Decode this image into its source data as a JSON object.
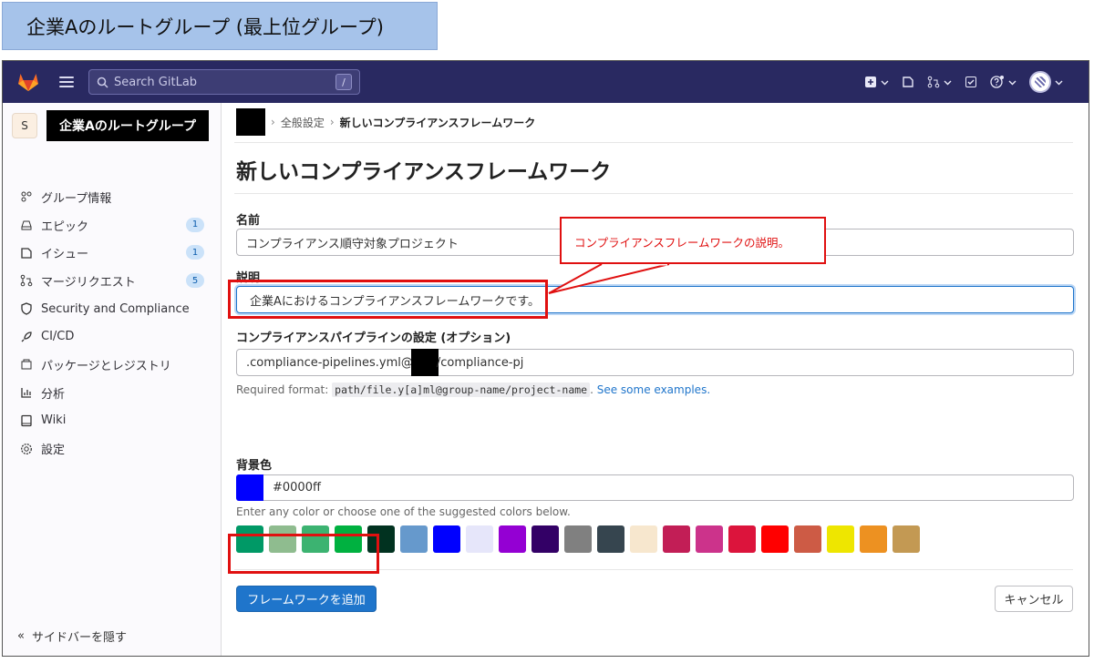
{
  "caption": "企業Aのルートグループ (最上位グループ)",
  "topbar": {
    "search_placeholder": "Search GitLab",
    "search_shortcut": "/"
  },
  "sidebar": {
    "group_avatar_letter": "S",
    "group_name": "企業Aのルートグループ",
    "items": [
      {
        "label": "グループ情報",
        "icon": "group-info-icon",
        "badge": ""
      },
      {
        "label": "エピック",
        "icon": "epic-icon",
        "badge": "1"
      },
      {
        "label": "イシュー",
        "icon": "issues-icon",
        "badge": "1"
      },
      {
        "label": "マージリクエスト",
        "icon": "merge-request-icon",
        "badge": "5"
      },
      {
        "label": "Security and Compliance",
        "icon": "shield-icon",
        "badge": ""
      },
      {
        "label": "CI/CD",
        "icon": "rocket-icon",
        "badge": ""
      },
      {
        "label": "パッケージとレジストリ",
        "icon": "package-icon",
        "badge": ""
      },
      {
        "label": "分析",
        "icon": "chart-icon",
        "badge": ""
      },
      {
        "label": "Wiki",
        "icon": "book-icon",
        "badge": ""
      },
      {
        "label": "設定",
        "icon": "gear-icon",
        "badge": ""
      }
    ],
    "collapse_label": "サイドバーを隠す"
  },
  "breadcrumb": {
    "settings": "全般設定",
    "current": "新しいコンプライアンスフレームワーク"
  },
  "page": {
    "title": "新しいコンプライアンスフレームワーク",
    "name_label": "名前",
    "name_value": "コンプライアンス順守対象プロジェクト",
    "description_label": "説明",
    "description_value": "企業Aにおけるコンプライアンスフレームワークです。",
    "pipeline_label": "コンプライアンスパイプラインの設定 (オプション)",
    "pipeline_value_prefix": ".compliance-pipelines.yml@",
    "pipeline_value_suffix": "/compliance-pj",
    "required_format_prefix": "Required format:",
    "required_format_code": "path/file.y[a]ml@group-name/project-name",
    "required_format_link": "See some examples.",
    "color_label": "背景色",
    "color_value": "#0000ff",
    "color_help": "Enter any color or choose one of the suggested colors below.",
    "swatches": [
      "#009966",
      "#8fbc8f",
      "#3cb371",
      "#00b140",
      "#013220",
      "#6699cc",
      "#0000ff",
      "#e6e6fa",
      "#9400d3",
      "#330066",
      "#808080",
      "#36454f",
      "#f7e7ce",
      "#c21e56",
      "#cc338b",
      "#dc143c",
      "#ff0000",
      "#cd5b45",
      "#eee600",
      "#ed9121",
      "#c39953"
    ],
    "submit_label": "フレームワークを追加",
    "cancel_label": "キャンセル"
  },
  "annotation": {
    "callout_text": "コンプライアンスフレームワークの説明。"
  }
}
